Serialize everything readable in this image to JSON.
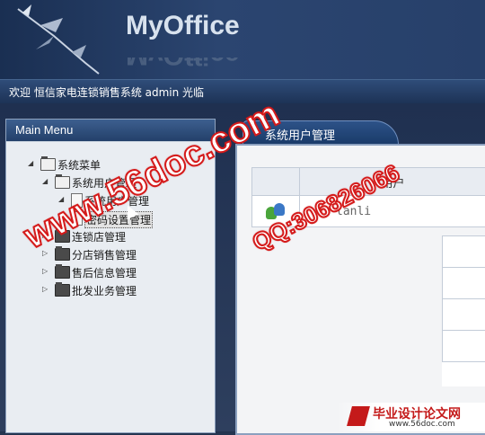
{
  "header": {
    "logo_text": "MyOffice"
  },
  "welcome_bar": {
    "text": "欢迎 恒信家电连锁销售系统 admin 光临"
  },
  "sidebar": {
    "title": "Main Menu",
    "tree": [
      {
        "label": "系统菜单",
        "expanded": true,
        "level": 0,
        "kind": "folder"
      },
      {
        "label": "系统用户管理",
        "expanded": true,
        "level": 1,
        "kind": "folder"
      },
      {
        "label": "系统用户管理",
        "expanded": true,
        "level": 2,
        "kind": "doc"
      },
      {
        "label": "密码设置管理",
        "expanded": false,
        "level": 2,
        "kind": "doc",
        "selected": true
      },
      {
        "label": "连锁店管理",
        "expanded": false,
        "level": 1,
        "kind": "folder"
      },
      {
        "label": "分店销售管理",
        "expanded": false,
        "level": 1,
        "kind": "folder"
      },
      {
        "label": "售后信息管理",
        "expanded": false,
        "level": 1,
        "kind": "folder"
      },
      {
        "label": "批发业务管理",
        "expanded": false,
        "level": 1,
        "kind": "folder"
      }
    ]
  },
  "tab": {
    "label": "系统用户管理"
  },
  "table": {
    "headers": [
      "",
      "用户"
    ],
    "rows": [
      {
        "icon": "users-icon",
        "name": "lanli"
      }
    ]
  },
  "watermarks": {
    "site": "www.56doc.com",
    "qq": "QQ:306826066",
    "footer_title": "毕业设计论文网",
    "footer_url": "www.56doc.com"
  },
  "colors": {
    "header_bg": "#2b4570",
    "watermark_red": "#d51a1a",
    "panel_border": "#8ba0bf"
  }
}
